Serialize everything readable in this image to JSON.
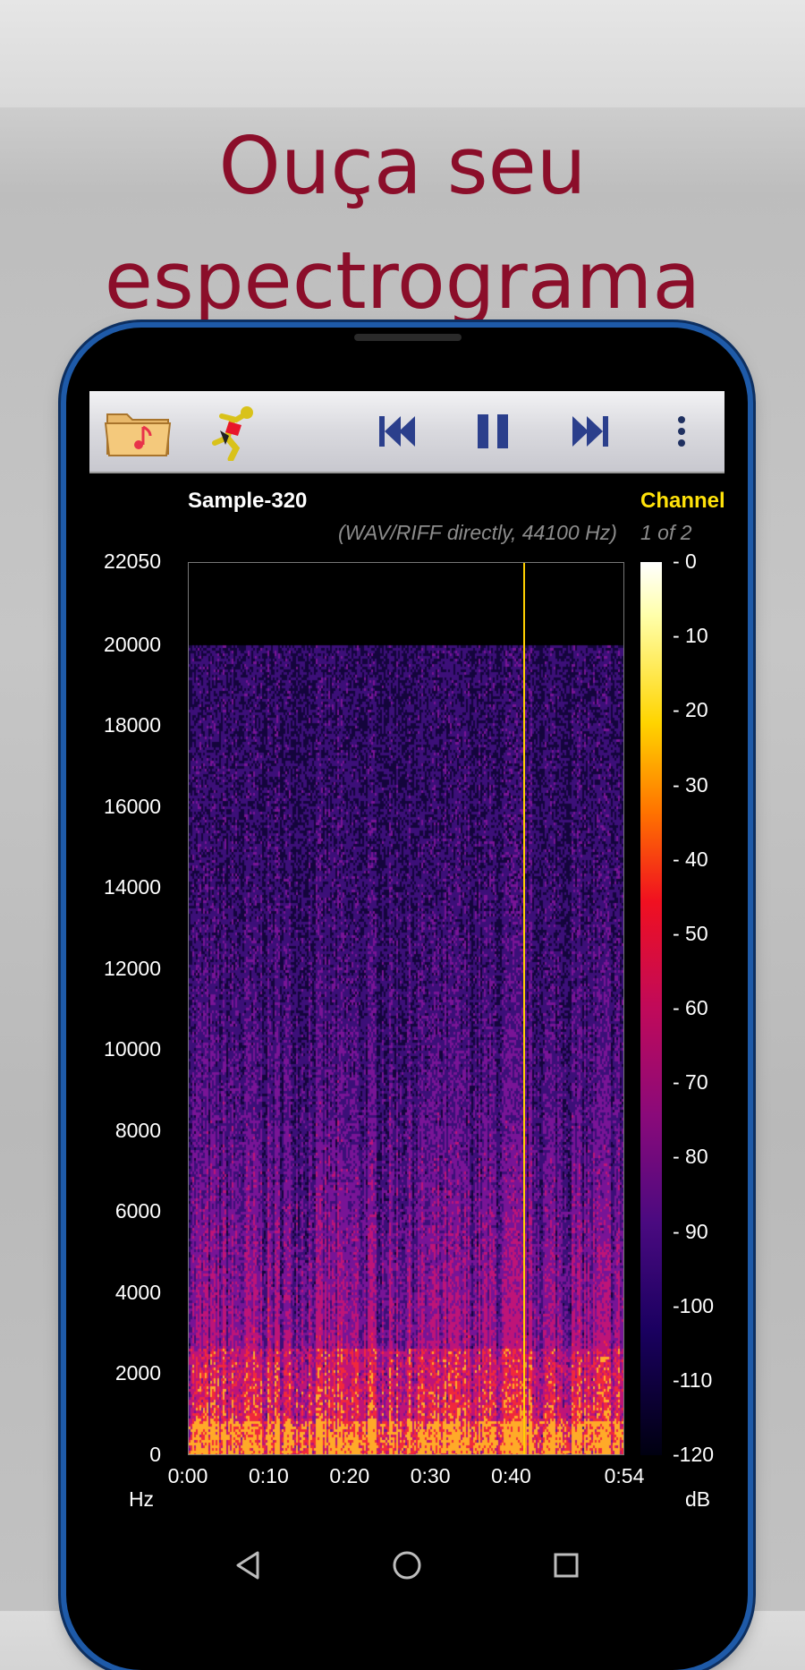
{
  "headline": {
    "line1": "Ouça seu",
    "line2": "espectrograma"
  },
  "toolbar": {
    "icons": [
      "folder-music-icon",
      "runner-icon",
      "skip-previous-icon",
      "pause-icon",
      "skip-next-icon",
      "more-vert-icon"
    ]
  },
  "file": {
    "title": "Sample-320",
    "info": "(WAV/RIFF directly, 44100 Hz)",
    "channel_label": "Channel",
    "channel_value": "1 of 2"
  },
  "y_axis": {
    "ticks": [
      "22050",
      "20000",
      "18000",
      "16000",
      "14000",
      "12000",
      "10000",
      "8000",
      "6000",
      "4000",
      "2000",
      "0"
    ],
    "unit": "Hz"
  },
  "x_axis": {
    "ticks": [
      "0:00",
      "0:10",
      "0:20",
      "0:30",
      "0:40",
      "0:54"
    ]
  },
  "colorbar": {
    "ticks": [
      "- 0",
      "- 10",
      "- 20",
      "- 30",
      "- 40",
      "- 50",
      "- 60",
      "- 70",
      "- 80",
      "- 90",
      "-100",
      "-110",
      "-120"
    ],
    "unit": "dB"
  },
  "playhead_time": "0:41",
  "colors": {
    "headline": "#8b0e2a",
    "channel": "#ffe20a",
    "playhead": "#ffd000",
    "phone_frame": "#1e5aa8"
  },
  "chart_data": {
    "type": "heatmap",
    "title": "Sample-320",
    "xlabel": "",
    "ylabel": "Hz",
    "x_ticks": [
      "0:00",
      "0:10",
      "0:20",
      "0:30",
      "0:40",
      "0:54"
    ],
    "y_ticks": [
      0,
      2000,
      4000,
      6000,
      8000,
      10000,
      12000,
      14000,
      16000,
      18000,
      20000,
      22050
    ],
    "ylim": [
      0,
      22050
    ],
    "xlim_seconds": [
      0,
      54
    ],
    "colorbar_range_db": [
      -120,
      0
    ],
    "colorbar_label": "dB",
    "playhead_seconds": 41.5
  }
}
